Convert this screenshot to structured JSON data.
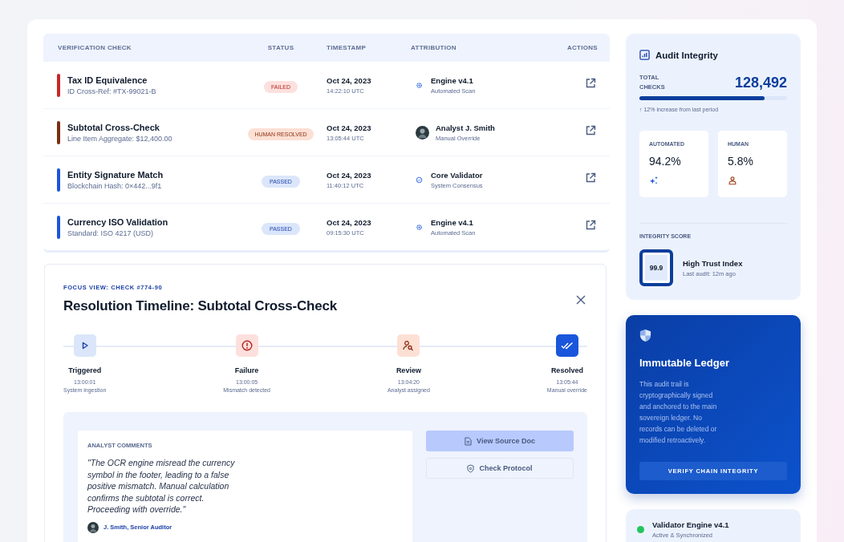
{
  "table": {
    "columns": [
      "VERIFICATION CHECK",
      "STATUS",
      "TIMESTAMP",
      "ATTRIBUTION",
      "ACTIONS"
    ],
    "rows": [
      {
        "title": "Tax ID Equivalence",
        "detail": "ID Cross-Ref: #TX-99021-B",
        "color": "#c62828",
        "status": {
          "kind": "failed",
          "label": "FAILED"
        },
        "date": "Oct 24, 2023",
        "time": "14:22:10 UTC",
        "attribution": {
          "kind": "engine",
          "name": "Engine v4.1",
          "sub": "Automated Scan"
        }
      },
      {
        "title": "Subtotal Cross-Check",
        "detail": "Line Item Aggregate: $12,400.00",
        "color": "#7a2e12",
        "status": {
          "kind": "human",
          "label": "HUMAN RESOLVED"
        },
        "date": "Oct 24, 2023",
        "time": "13:05:44 UTC",
        "attribution": {
          "kind": "person",
          "name": "Analyst J. Smith",
          "sub": "Manual Override"
        }
      },
      {
        "title": "Entity Signature Match",
        "detail": "Blockchain Hash: 0×442...9f1",
        "color": "#1a56db",
        "status": {
          "kind": "passed",
          "label": "PASSED"
        },
        "date": "Oct 24, 2023",
        "time": "11:40:12 UTC",
        "attribution": {
          "kind": "validator",
          "name": "Core Validator",
          "sub": "System Consensus"
        }
      },
      {
        "title": "Currency ISO Validation",
        "detail": "Standard: ISO 4217 (USD)",
        "color": "#1a56db",
        "status": {
          "kind": "passed",
          "label": "PASSED"
        },
        "date": "Oct 24, 2023",
        "time": "09:15:30 UTC",
        "attribution": {
          "kind": "engine",
          "name": "Engine v4.1",
          "sub": "Automated Scan"
        }
      }
    ]
  },
  "focus": {
    "eyebrow": "FOCUS VIEW: CHECK #774-90",
    "title": "Resolution Timeline: Subtotal Cross-Check",
    "steps": [
      {
        "kind": "trigger",
        "label": "Triggered",
        "time": "13:00:01",
        "note": "System ingestion"
      },
      {
        "kind": "failure",
        "label": "Failure",
        "time": "13:00:05",
        "note": "Mismatch detected"
      },
      {
        "kind": "review",
        "label": "Review",
        "time": "13:04:20",
        "note": "Analyst assigned"
      },
      {
        "kind": "resolved",
        "label": "Resolved",
        "time": "13:05:44",
        "note": "Manual override"
      }
    ],
    "comments": {
      "heading": "ANALYST COMMENTS",
      "quote": "\"The OCR engine misread the currency symbol in the footer, leading to a false positive mismatch. Manual calculation confirms the subtotal is correct. Proceeding with override.\"",
      "author": "J. Smith, Senior Auditor"
    },
    "actions": [
      {
        "kind": "primary",
        "label": "View Source Doc"
      },
      {
        "kind": "secondary",
        "label": "Check Protocol"
      }
    ]
  },
  "audit": {
    "title": "Audit Integrity",
    "total_label": "TOTAL CHECKS",
    "total": "128,492",
    "level": 0.85,
    "trend": "↑ 12% increase from last period",
    "split": [
      {
        "kind": "automated",
        "label": "AUTOMATED",
        "value": "94.2%"
      },
      {
        "kind": "human",
        "label": "HUMAN",
        "value": "5.8%"
      }
    ],
    "score_label": "INTEGRITY SCORE",
    "score": "99.9",
    "score_title": "High Trust Index",
    "score_sub": "Last audit: 12m ago"
  },
  "ledger": {
    "title": "Immutable Ledger",
    "text": "This audit trail is cryptographically signed and anchored to the main sovereign ledger. No records can be deleted or modified retroactively.",
    "button": "VERIFY CHAIN INTEGRITY"
  },
  "validator": {
    "name": "Validator Engine v4.1",
    "status": "Active & Synchronized",
    "color": "#22c55e"
  }
}
